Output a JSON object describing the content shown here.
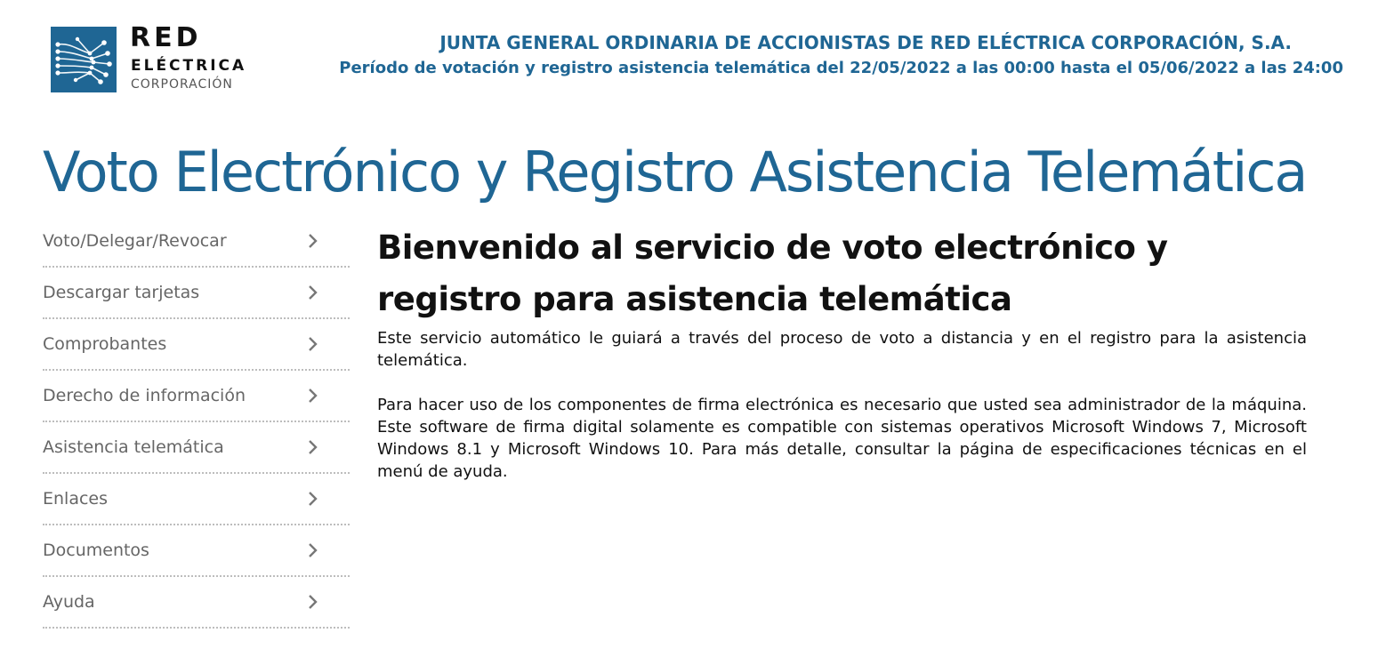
{
  "header": {
    "logo": {
      "name": "RED",
      "line2": "ELÉCTRICA",
      "line3": "CORPORACIÓN"
    },
    "title": "JUNTA GENERAL ORDINARIA DE ACCIONISTAS DE RED ELÉCTRICA CORPORACIÓN, S.A.",
    "period": "Período de votación y registro asistencia telemática del 22/05/2022 a las 00:00 hasta el 05/06/2022 a las 24:00"
  },
  "page_title": "Voto Electrónico y Registro Asistencia Telemática",
  "sidebar": {
    "items": [
      {
        "label": "Voto/Delegar/Revocar",
        "icon": "chevron-right-icon"
      },
      {
        "label": "Descargar tarjetas",
        "icon": "chevron-right-icon"
      },
      {
        "label": "Comprobantes",
        "icon": "chevron-right-icon"
      },
      {
        "label": "Derecho de información",
        "icon": "chevron-right-icon"
      },
      {
        "label": "Asistencia telemática",
        "icon": "chevron-right-icon"
      },
      {
        "label": "Enlaces",
        "icon": "chevron-right-icon"
      },
      {
        "label": "Documentos",
        "icon": "chevron-right-icon"
      },
      {
        "label": "Ayuda",
        "icon": "chevron-right-icon"
      }
    ]
  },
  "main": {
    "heading": "Bienvenido al servicio de voto electrónico y registro para asistencia telemática",
    "paragraph1": "Este servicio automático le guiará a través del proceso de voto a distancia y en el registro para la asistencia telemática.",
    "paragraph2": "Para hacer uso de los componentes de firma electrónica es necesario que usted sea administrador de la máquina. Este software de firma digital solamente es compatible con sistemas operativos Microsoft Windows 7, Microsoft Windows 8.1 y Microsoft Windows 10. Para más detalle, consultar la página de especificaciones técnicas en el menú de ayuda."
  },
  "colors": {
    "brand_blue": "#1f6694",
    "text": "#111111",
    "sidebar_text": "#666666",
    "divider": "#bdbdbd"
  }
}
